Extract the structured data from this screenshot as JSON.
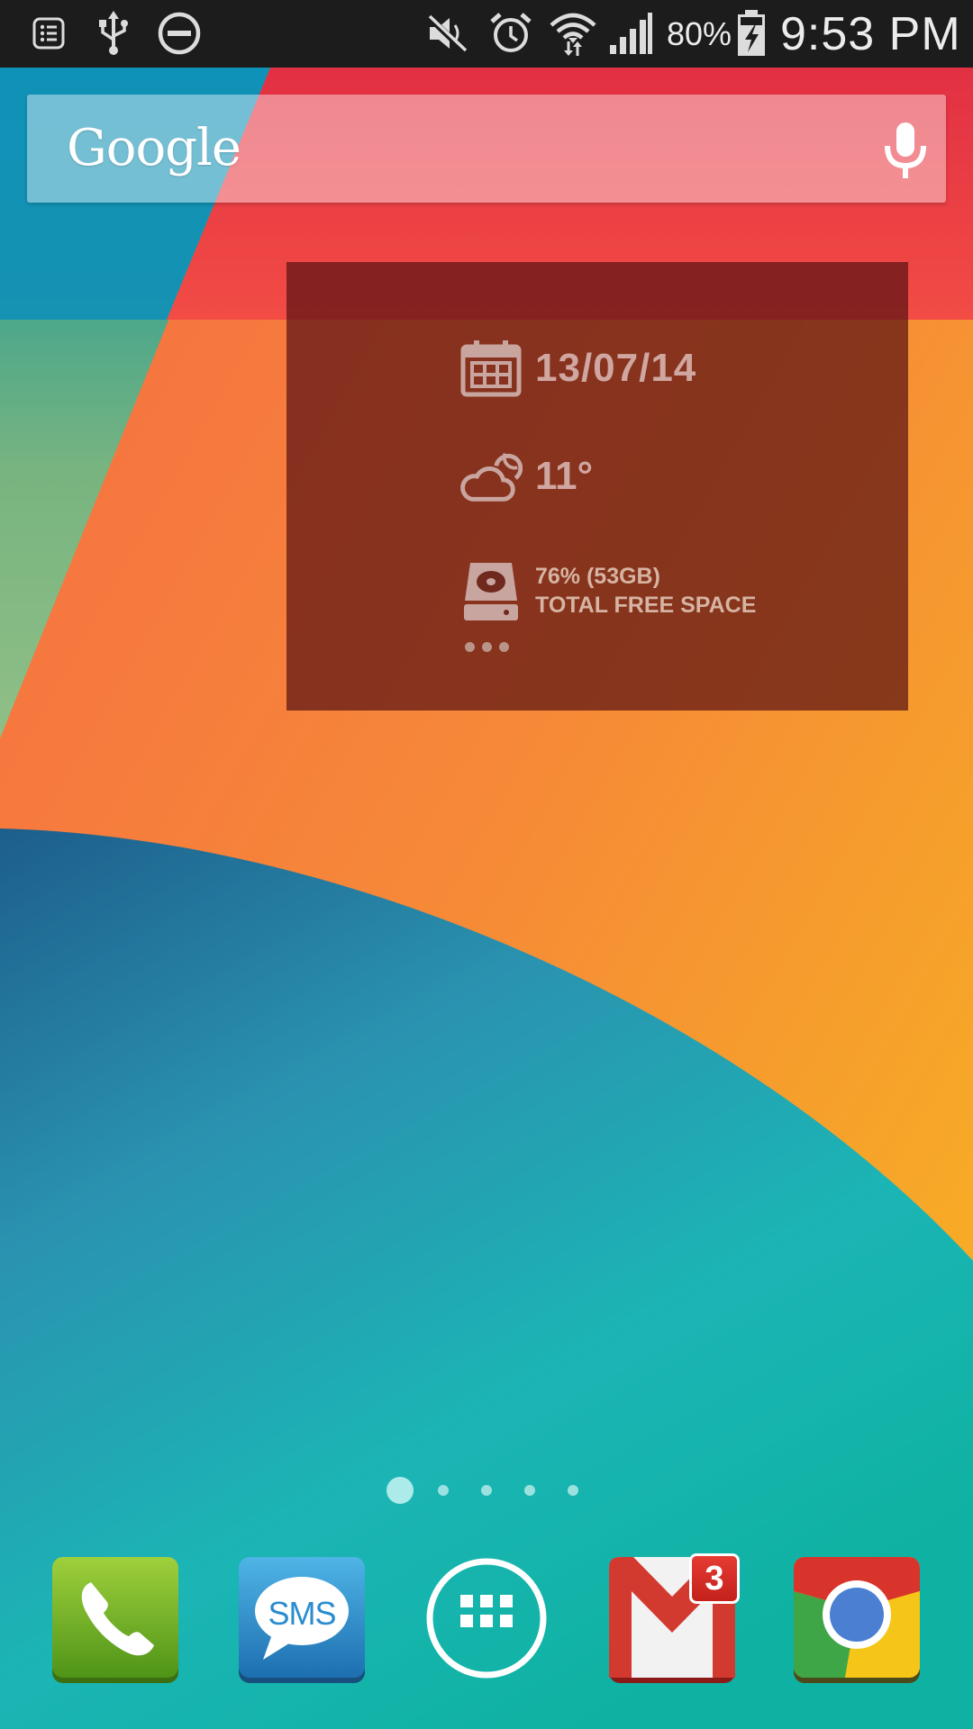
{
  "status_bar": {
    "left_icons": [
      "notification-list-icon",
      "usb-icon",
      "do-not-disturb-icon"
    ],
    "right_icons": [
      "mute-icon",
      "alarm-icon",
      "wifi-icon",
      "signal-icon",
      "battery-charging-icon"
    ],
    "battery_percent": "80%",
    "time": "9:53 PM"
  },
  "search": {
    "brand": "Google",
    "mic_icon": "microphone-icon"
  },
  "widget": {
    "date": "13/07/14",
    "temperature": "11°",
    "storage_line1": "76% (53GB)",
    "storage_line2": "TOTAL FREE SPACE",
    "icons": [
      "calendar-icon",
      "partly-cloudy-icon",
      "hard-drive-icon",
      "more-icon"
    ],
    "background": "#5c1414"
  },
  "pages": {
    "count": 5,
    "current": 1
  },
  "dock": {
    "apps": [
      {
        "name": "Phone",
        "icon": "phone-icon"
      },
      {
        "name": "Messages",
        "icon": "sms-icon",
        "label": "SMS"
      },
      {
        "name": "Apps",
        "icon": "app-drawer-icon"
      },
      {
        "name": "Gmail",
        "icon": "gmail-icon",
        "badge": "3"
      },
      {
        "name": "Chrome",
        "icon": "chrome-icon"
      }
    ]
  }
}
